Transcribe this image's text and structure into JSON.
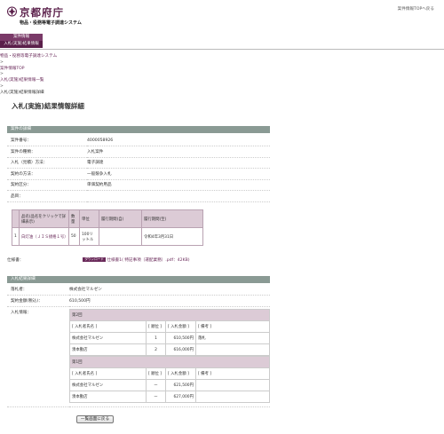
{
  "header": {
    "logo_text": "京都府庁",
    "logo_sub": "物品・役務等電子調達システム",
    "top_link": "案件情報TOPへ戻る"
  },
  "nav": {
    "items": [
      "案件情報",
      "入札(実施)結果情報"
    ]
  },
  "breadcrumb": {
    "items": [
      "物品・役務等電子調達システム",
      "案件情報TOP",
      "入札(実施)結果情報一覧",
      "入札(実施)結果情報詳細"
    ],
    "separator": ">"
  },
  "page_title": "入札(実施)結果情報詳細",
  "case_section": {
    "title": "案件の詳細",
    "rows": [
      {
        "label": "案件番号：",
        "value": "4000058926"
      },
      {
        "label": "案件の種類：",
        "value": "入札案件"
      },
      {
        "label": "入札（見積）方法：",
        "value": "電子調達"
      },
      {
        "label": "契約の方法：",
        "value": "一般競争入札"
      },
      {
        "label": "契約区分：",
        "value": "単価契約用品"
      },
      {
        "label": "品目：",
        "value": ""
      }
    ]
  },
  "items_table": {
    "headers": [
      "品名(品名をクリックで詳細表示)",
      "数量",
      "単位",
      "履行期間(自)",
      "履行期間(至)"
    ],
    "rows": [
      {
        "no": "1",
        "name": "白灯油（ＪＩＳ規格１号）",
        "qty": "50",
        "unit": "100リットル",
        "from": "",
        "to": "令和4年3月31日"
      }
    ]
  },
  "spec": {
    "label": "仕様書：",
    "badge": "ダウンロード",
    "file": "仕様書1( 特記事項（運配業務）.pdf：42KB)"
  },
  "result_section": {
    "title": "入札結果詳細",
    "rows": [
      {
        "label": "落札者：",
        "value": "株式会社マルゼン"
      },
      {
        "label": "契約金額(税込)：",
        "value": "610,500円"
      },
      {
        "label": "入札情報：",
        "value": ""
      }
    ]
  },
  "rounds": [
    {
      "title": "第2回",
      "headers": [
        "[ 入札者氏名 ]",
        "[ 順位 ]",
        "[ 入札金額 ]",
        "[ 備考 ]"
      ],
      "rows": [
        {
          "name": "株式会社マルゼン",
          "rank": "1",
          "amount": "610,500円",
          "note": "落札"
        },
        {
          "name": "湊本勤店",
          "rank": "2",
          "amount": "616,000円",
          "note": ""
        }
      ]
    },
    {
      "title": "第1回",
      "headers": [
        "[ 入札者氏名 ]",
        "[ 順位 ]",
        "[ 入札金額 ]",
        "[ 備考 ]"
      ],
      "rows": [
        {
          "name": "株式会社マルゼン",
          "rank": "ー",
          "amount": "621,500円",
          "note": ""
        },
        {
          "name": "湊本勤店",
          "rank": "ー",
          "amount": "627,000円",
          "note": ""
        }
      ]
    }
  ],
  "buttons": {
    "back": "一覧画面に戻る"
  }
}
